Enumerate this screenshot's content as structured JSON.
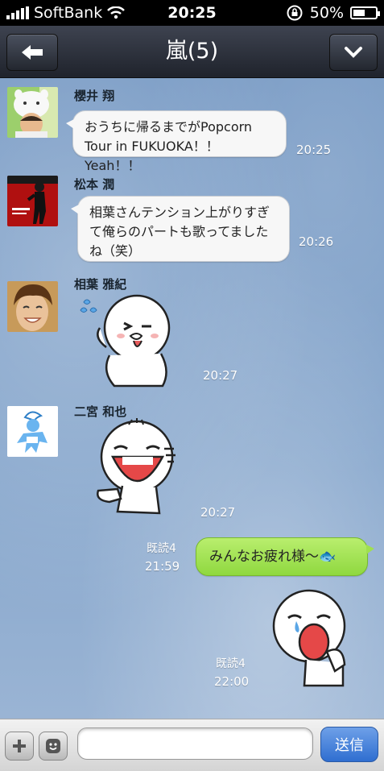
{
  "status_bar": {
    "carrier": "SoftBank",
    "time": "20:25",
    "battery": "50%"
  },
  "header": {
    "title": "嵐(5)",
    "back_icon": "back-arrow-icon",
    "menu_icon": "chevron-down-icon"
  },
  "messages": [
    {
      "sender": "櫻井 翔",
      "text": "おうちに帰るまでがPopcorn Tour in FUKUOKA！！Yeah！！",
      "time": "20:25"
    },
    {
      "sender": "松本 潤",
      "text": "相葉さんテンション上がりすぎて俺らのパートも歌ってましたね（笑）",
      "time": "20:26"
    },
    {
      "sender": "相葉 雅紀",
      "sticker": "wink-sticker",
      "time": "20:27"
    },
    {
      "sender": "二宮 和也",
      "sticker": "laughing-sticker",
      "time": "20:27"
    }
  ],
  "own_messages": [
    {
      "read": "既読4",
      "time": "21:59",
      "text": "みんなお疲れ様〜🐟"
    },
    {
      "read": "既読4",
      "time": "22:00",
      "sticker": "crying-sticker"
    }
  ],
  "input": {
    "placeholder": "",
    "send_label": "送信"
  },
  "colors": {
    "nav_bg": "#2b2f39",
    "own_bubble": "#9fe04e",
    "send_button": "#3a78d6"
  }
}
